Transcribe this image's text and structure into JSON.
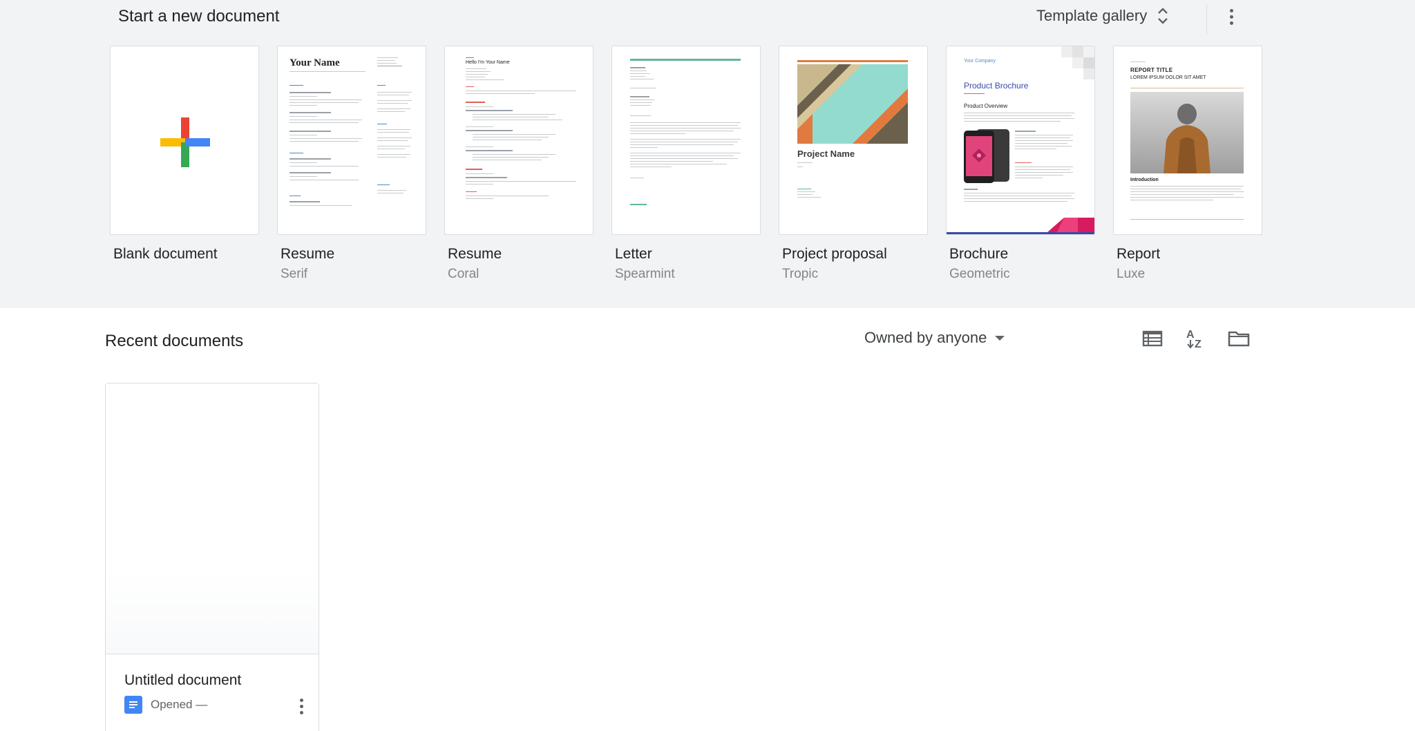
{
  "new_document": {
    "title": "Start a new document",
    "gallery_label": "Template gallery",
    "more_icon": "more-vert-icon"
  },
  "templates": [
    {
      "name": "Blank document",
      "subtitle": ""
    },
    {
      "name": "Resume",
      "subtitle": "Serif",
      "preview_heading": "Your Name"
    },
    {
      "name": "Resume",
      "subtitle": "Coral",
      "preview_heading": "Hello I'm Your Name"
    },
    {
      "name": "Letter",
      "subtitle": "Spearmint",
      "preview_heading": ""
    },
    {
      "name": "Project proposal",
      "subtitle": "Tropic",
      "preview_heading": "Project Name"
    },
    {
      "name": "Brochure",
      "subtitle": "Geometric",
      "preview_company": "Your Company",
      "preview_heading": "Product Brochure",
      "preview_section": "Product Overview"
    },
    {
      "name": "Report",
      "subtitle": "Luxe",
      "preview_heading": "REPORT TITLE",
      "preview_sub": "LOREM IPSUM DOLOR SIT AMET",
      "preview_section": "Introduction"
    }
  ],
  "recent": {
    "title": "Recent documents",
    "owner_filter": "Owned by anyone",
    "icons": [
      "list-view-icon",
      "sort-az-icon",
      "folder-icon"
    ]
  },
  "documents": [
    {
      "title": "Untitled document",
      "opened": "Opened —"
    }
  ],
  "colors": {
    "background_top": "#f1f3f4",
    "docs_blue": "#4285f4",
    "plus_red": "#ea4335",
    "plus_yellow": "#fbbc04",
    "plus_green": "#34a853"
  }
}
